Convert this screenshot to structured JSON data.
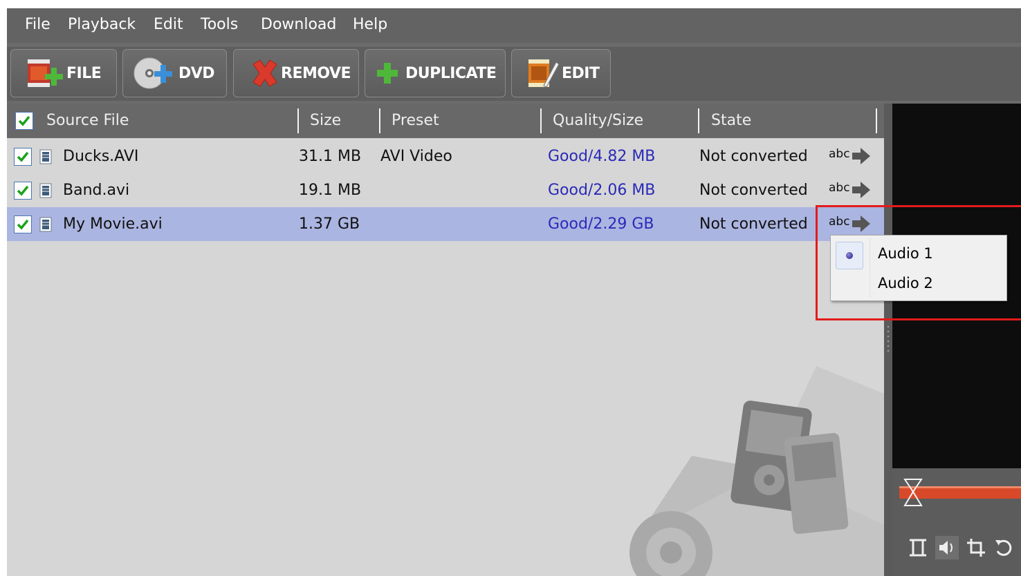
{
  "menu": [
    "File",
    "Playback",
    "Edit",
    "Tools",
    "Download",
    "Help"
  ],
  "toolbar": {
    "file": "FILE",
    "dvd": "DVD",
    "remove": "REMOVE",
    "duplicate": "DUPLICATE",
    "edit": "EDIT"
  },
  "columns": {
    "source": "Source File",
    "size": "Size",
    "preset": "Preset",
    "quality": "Quality/Size",
    "state": "State"
  },
  "rows": [
    {
      "name": "Ducks.AVI",
      "size": "31.1 MB",
      "preset": "AVI Video",
      "quality": "Good/4.82 MB",
      "state": "Not converted",
      "subtitle_label": "abc",
      "checked": true,
      "selected": false
    },
    {
      "name": "Band.avi",
      "size": "19.1 MB",
      "preset": "",
      "quality": "Good/2.06 MB",
      "state": "Not converted",
      "subtitle_label": "abc",
      "checked": true,
      "selected": false
    },
    {
      "name": "My Movie.avi",
      "size": "1.37 GB",
      "preset": "",
      "quality": "Good/2.29 GB",
      "state": "Not converted",
      "subtitle_label": "abc",
      "checked": true,
      "selected": true
    }
  ],
  "audio_menu": {
    "options": [
      "Audio 1",
      "Audio 2"
    ],
    "selected": "Audio 1"
  },
  "colors": {
    "highlight_box": "#e31b1b",
    "selected_row": "#abb5e1",
    "quality_text": "#2a2ab8",
    "timeline_bar": "#d8492a"
  }
}
